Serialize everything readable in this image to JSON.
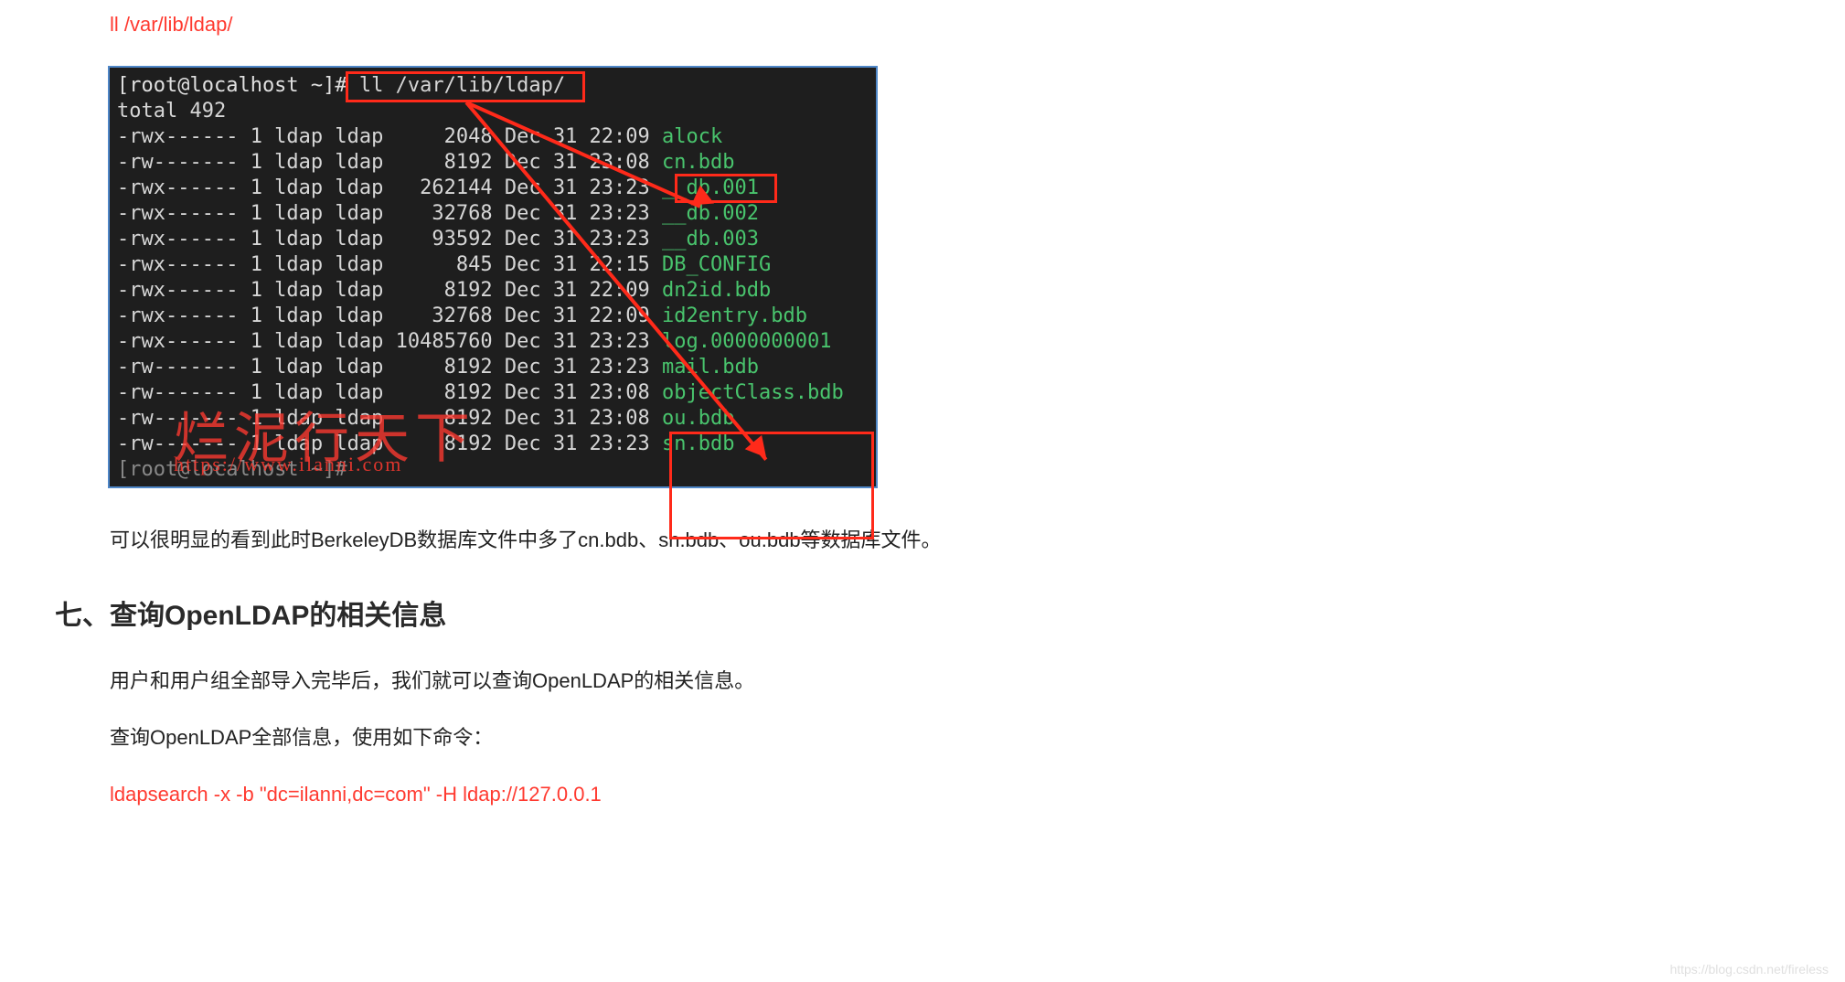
{
  "cmd1": "ll /var/lib/ldap/",
  "terminal": {
    "prompt": "[root@localhost ~]# ",
    "cmd": "ll /var/lib/ldap/",
    "total": "total 492",
    "rows": [
      {
        "perm": "-rwx------",
        "ln": "1",
        "own": "ldap",
        "grp": "ldap",
        "size": "    2048",
        "date": "Dec 31 22:09",
        "name": "alock"
      },
      {
        "perm": "-rw-------",
        "ln": "1",
        "own": "ldap",
        "grp": "ldap",
        "size": "    8192",
        "date": "Dec 31 23:08",
        "name": "cn.bdb"
      },
      {
        "perm": "-rwx------",
        "ln": "1",
        "own": "ldap",
        "grp": "ldap",
        "size": "  262144",
        "date": "Dec 31 23:23",
        "name": "__db.001"
      },
      {
        "perm": "-rwx------",
        "ln": "1",
        "own": "ldap",
        "grp": "ldap",
        "size": "   32768",
        "date": "Dec 31 23:23",
        "name": "__db.002"
      },
      {
        "perm": "-rwx------",
        "ln": "1",
        "own": "ldap",
        "grp": "ldap",
        "size": "   93592",
        "date": "Dec 31 23:23",
        "name": "__db.003"
      },
      {
        "perm": "-rwx------",
        "ln": "1",
        "own": "ldap",
        "grp": "ldap",
        "size": "     845",
        "date": "Dec 31 22:15",
        "name": "DB_CONFIG"
      },
      {
        "perm": "-rwx------",
        "ln": "1",
        "own": "ldap",
        "grp": "ldap",
        "size": "    8192",
        "date": "Dec 31 22:09",
        "name": "dn2id.bdb"
      },
      {
        "perm": "-rwx------",
        "ln": "1",
        "own": "ldap",
        "grp": "ldap",
        "size": "   32768",
        "date": "Dec 31 22:09",
        "name": "id2entry.bdb"
      },
      {
        "perm": "-rwx------",
        "ln": "1",
        "own": "ldap",
        "grp": "ldap",
        "size": "10485760",
        "date": "Dec 31 23:23",
        "name": "log.0000000001"
      },
      {
        "perm": "-rw-------",
        "ln": "1",
        "own": "ldap",
        "grp": "ldap",
        "size": "    8192",
        "date": "Dec 31 23:23",
        "name": "mail.bdb"
      },
      {
        "perm": "-rw-------",
        "ln": "1",
        "own": "ldap",
        "grp": "ldap",
        "size": "    8192",
        "date": "Dec 31 23:08",
        "name": "objectClass.bdb"
      },
      {
        "perm": "-rw-------",
        "ln": "1",
        "own": "ldap",
        "grp": "ldap",
        "size": "    8192",
        "date": "Dec 31 23:08",
        "name": "ou.bdb"
      },
      {
        "perm": "-rw-------",
        "ln": "1",
        "own": "ldap",
        "grp": "ldap",
        "size": "    8192",
        "date": "Dec 31 23:23",
        "name": "sn.bdb"
      }
    ],
    "lastline": "[root@localhost ~]#",
    "watermark_cn": "烂泥行天下",
    "watermark_url": "https://www.ilanni.com"
  },
  "para_after_img": "可以很明显的看到此时BerkeleyDB数据库文件中多了cn.bdb、sn.bdb、ou.bdb等数据库文件。",
  "heading7": "七、查询OpenLDAP的相关信息",
  "para7_1": "用户和用户组全部导入完毕后，我们就可以查询OpenLDAP的相关信息。",
  "para7_2": "查询OpenLDAP全部信息，使用如下命令：",
  "cmd2": "ldapsearch -x -b \"dc=ilanni,dc=com\" -H ldap://127.0.0.1",
  "footer_wm": "https://blog.csdn.net/fireless"
}
